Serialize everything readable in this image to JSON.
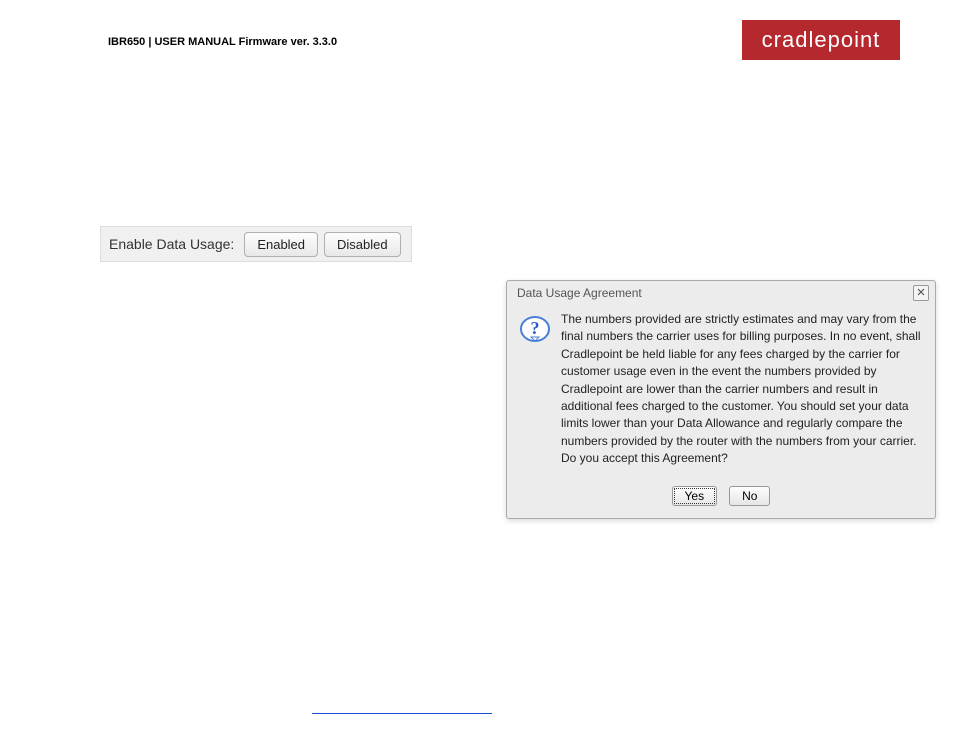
{
  "header": {
    "breadcrumb": "IBR650 | USER MANUAL Firmware ver. 3.3.0"
  },
  "logo": {
    "text": "cradlepoint"
  },
  "togglePanel": {
    "label": "Enable Data Usage:",
    "enabled": "Enabled",
    "disabled": "Disabled"
  },
  "dialog": {
    "title": "Data Usage Agreement",
    "body": "The numbers provided are strictly estimates and may vary from the final numbers the carrier uses for billing purposes. In no event, shall Cradlepoint be held liable for any fees charged by the carrier for customer usage even in the event the numbers provided by Cradlepoint are lower than the carrier numbers and result in additional fees charged to the customer. You should set your data limits lower than your Data Allowance and regularly compare the numbers provided by the router with the numbers from your carrier. Do you accept this Agreement?",
    "yes": "Yes",
    "no": "No"
  }
}
